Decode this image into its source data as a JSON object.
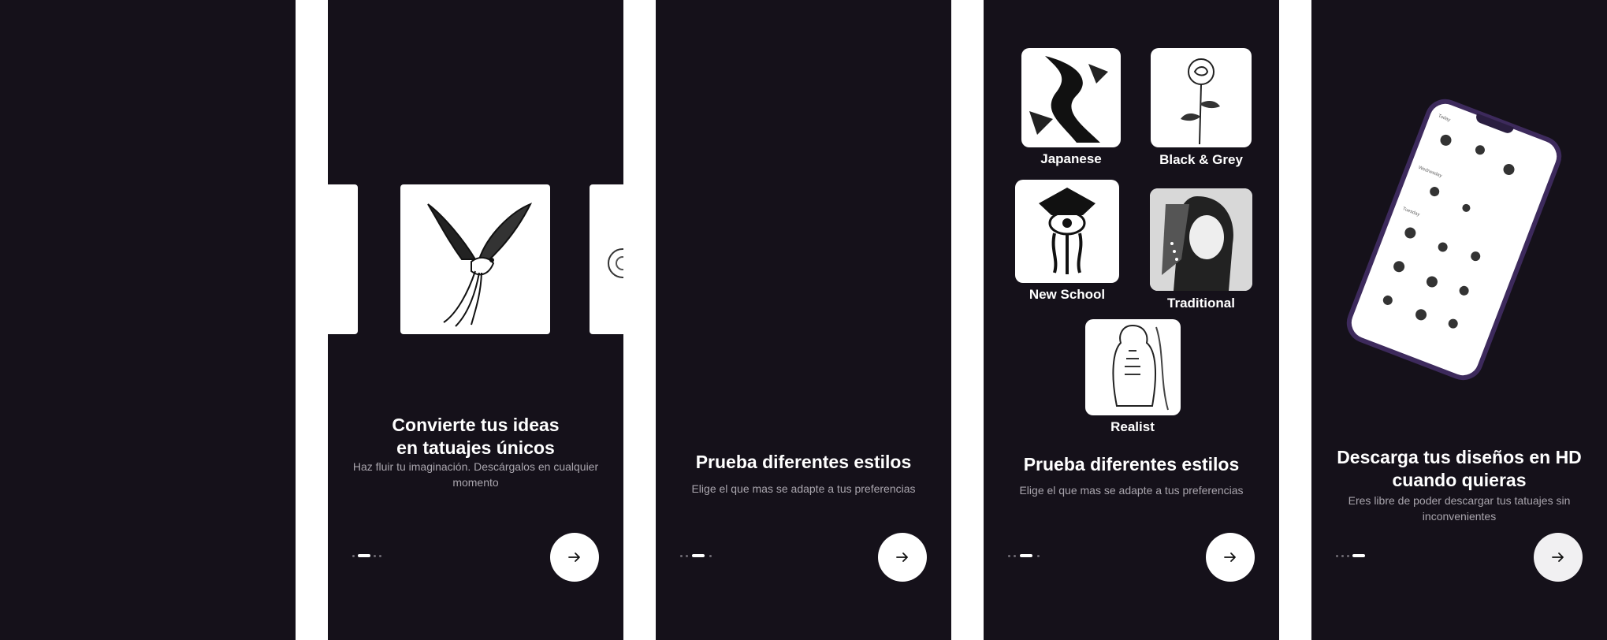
{
  "screens": {
    "converter": {
      "title": "Convierte tus ideas\nen tatuajes únicos",
      "subtitle": "Haz fluir tu imaginación. Descárgalos en cualquier\nmomento"
    },
    "styles_empty": {
      "title": "Prueba diferentes estilos",
      "subtitle": "Elige el que mas se adapte a tus preferencias"
    },
    "styles_grid": {
      "title": "Prueba diferentes estilos",
      "subtitle": "Elige el que mas se adapte a tus preferencias",
      "styles": [
        {
          "label": "Japanese"
        },
        {
          "label": "Black & Grey"
        },
        {
          "label": "New School"
        },
        {
          "label": "Traditional"
        },
        {
          "label": "Realist"
        }
      ]
    },
    "download": {
      "title": "Descarga tus diseños en HD\ncuando quieras",
      "subtitle": "Eres libre de poder descargar tus tatuajes sin\ninconvenientes",
      "phone_sections": [
        "Today",
        "Wednesday",
        "Tuesday"
      ]
    }
  },
  "pagination": {
    "converter": {
      "active_index": 1,
      "count": 4
    },
    "styles_empty": {
      "active_index": 2,
      "count": 4
    },
    "styles_grid": {
      "active_index": 2,
      "count": 4
    },
    "download": {
      "active_index": 3,
      "count": 4
    }
  },
  "colors": {
    "screen_bg": "#15111a",
    "gap_bg": "#ffffff",
    "accent_white": "#ffffff",
    "subtitle_gray": "#a9a5ad",
    "phone_frame": "#3d2a5c"
  },
  "icons": {
    "next_button": "arrow-right-icon",
    "main_card": "bird-tattoo-illustration"
  }
}
